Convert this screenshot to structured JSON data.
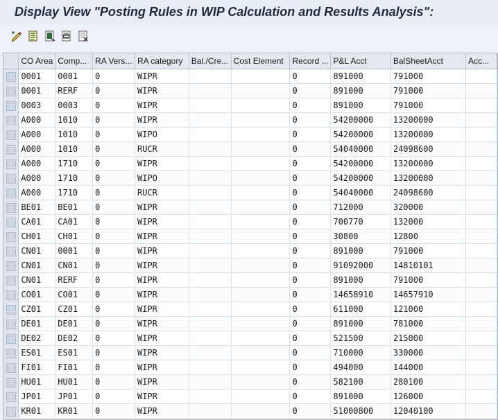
{
  "window": {
    "title": "Display View \"Posting Rules in WIP Calculation and Results Analysis\":"
  },
  "toolbar": {
    "buttons": [
      {
        "name": "change-display-icon"
      },
      {
        "name": "details-icon"
      },
      {
        "name": "select-all-icon"
      },
      {
        "name": "select-block-icon"
      },
      {
        "name": "deselect-all-icon"
      }
    ]
  },
  "table": {
    "columns": [
      "CO Area",
      "Comp...",
      "RA Vers...",
      "RA category",
      "Bal./Cre...",
      "Cost Element",
      "Record ...",
      "P&L Acct",
      "BalSheetAcct",
      "Acc..."
    ],
    "rows": [
      [
        "0001",
        "0001",
        "0",
        "WIPR",
        "",
        "",
        "0",
        "891000",
        "791000",
        ""
      ],
      [
        "0001",
        "RERF",
        "0",
        "WIPR",
        "",
        "",
        "0",
        "891000",
        "791000",
        ""
      ],
      [
        "0003",
        "0003",
        "0",
        "WIPR",
        "",
        "",
        "0",
        "891000",
        "791000",
        ""
      ],
      [
        "A000",
        "1010",
        "0",
        "WIPR",
        "",
        "",
        "0",
        "54200000",
        "13200000",
        ""
      ],
      [
        "A000",
        "1010",
        "0",
        "WIPO",
        "",
        "",
        "0",
        "54200000",
        "13200000",
        ""
      ],
      [
        "A000",
        "1010",
        "0",
        "RUCR",
        "",
        "",
        "0",
        "54040000",
        "24098600",
        ""
      ],
      [
        "A000",
        "1710",
        "0",
        "WIPR",
        "",
        "",
        "0",
        "54200000",
        "13200000",
        ""
      ],
      [
        "A000",
        "1710",
        "0",
        "WIPO",
        "",
        "",
        "0",
        "54200000",
        "13200000",
        ""
      ],
      [
        "A000",
        "1710",
        "0",
        "RUCR",
        "",
        "",
        "0",
        "54040000",
        "24098600",
        ""
      ],
      [
        "BE01",
        "BE01",
        "0",
        "WIPR",
        "",
        "",
        "0",
        "712000",
        "320000",
        ""
      ],
      [
        "CA01",
        "CA01",
        "0",
        "WIPR",
        "",
        "",
        "0",
        "700770",
        "132000",
        ""
      ],
      [
        "CH01",
        "CH01",
        "0",
        "WIPR",
        "",
        "",
        "0",
        "30800",
        "12800",
        ""
      ],
      [
        "CN01",
        "0001",
        "0",
        "WIPR",
        "",
        "",
        "0",
        "891000",
        "791000",
        ""
      ],
      [
        "CN01",
        "CN01",
        "0",
        "WIPR",
        "",
        "",
        "0",
        "91092000",
        "14810101",
        ""
      ],
      [
        "CN01",
        "RERF",
        "0",
        "WIPR",
        "",
        "",
        "0",
        "891000",
        "791000",
        ""
      ],
      [
        "CO01",
        "CO01",
        "0",
        "WIPR",
        "",
        "",
        "0",
        "14658910",
        "14657910",
        ""
      ],
      [
        "CZ01",
        "CZ01",
        "0",
        "WIPR",
        "",
        "",
        "0",
        "611000",
        "121000",
        ""
      ],
      [
        "DE01",
        "DE01",
        "0",
        "WIPR",
        "",
        "",
        "0",
        "891000",
        "781000",
        ""
      ],
      [
        "DE02",
        "DE02",
        "0",
        "WIPR",
        "",
        "",
        "0",
        "521500",
        "215000",
        ""
      ],
      [
        "ES01",
        "ES01",
        "0",
        "WIPR",
        "",
        "",
        "0",
        "710000",
        "330000",
        ""
      ],
      [
        "FI01",
        "FI01",
        "0",
        "WIPR",
        "",
        "",
        "0",
        "494000",
        "144000",
        ""
      ],
      [
        "HU01",
        "HU01",
        "0",
        "WIPR",
        "",
        "",
        "0",
        "582100",
        "280100",
        ""
      ],
      [
        "JP01",
        "JP01",
        "0",
        "WIPR",
        "",
        "",
        "0",
        "891000",
        "126000",
        ""
      ],
      [
        "KR01",
        "KR01",
        "0",
        "WIPR",
        "",
        "",
        "0",
        "51000800",
        "12040100",
        ""
      ]
    ]
  }
}
